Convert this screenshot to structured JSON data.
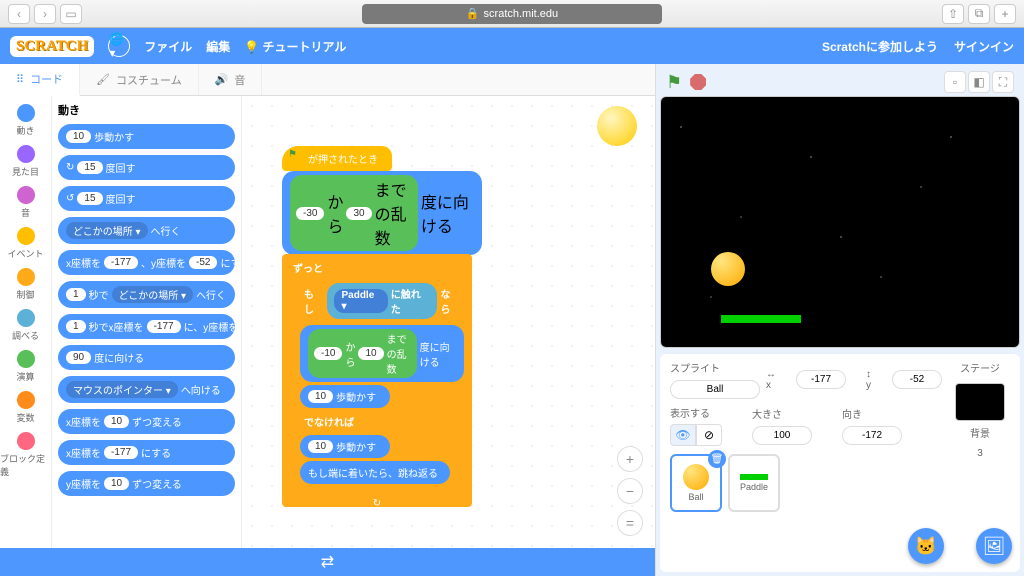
{
  "browser": {
    "url": "scratch.mit.edu"
  },
  "menu": {
    "file": "ファイル",
    "edit": "編集",
    "tutorials": "チュートリアル",
    "join": "Scratchに参加しよう",
    "signin": "サインイン"
  },
  "tabs": {
    "code": "コード",
    "costumes": "コスチューム",
    "sounds": "音"
  },
  "categories": [
    {
      "label": "動き",
      "color": "#4c97ff"
    },
    {
      "label": "見た目",
      "color": "#9966ff"
    },
    {
      "label": "音",
      "color": "#cf63cf"
    },
    {
      "label": "イベント",
      "color": "#ffbf00"
    },
    {
      "label": "制御",
      "color": "#ffab19"
    },
    {
      "label": "調べる",
      "color": "#5cb1d6"
    },
    {
      "label": "演算",
      "color": "#59c059"
    },
    {
      "label": "変数",
      "color": "#ff8c1a"
    },
    {
      "label": "ブロック定義",
      "color": "#ff6680"
    }
  ],
  "palette": {
    "heading": "動き",
    "blocks": {
      "move_steps": {
        "val": "10",
        "suf": "歩動かす"
      },
      "turn_cw": {
        "val": "15",
        "suf": "度回す"
      },
      "turn_ccw": {
        "val": "15",
        "suf": "度回す"
      },
      "goto": {
        "dd": "どこかの場所 ▾",
        "suf": "へ行く"
      },
      "gotoxy": {
        "pre": "x座標を",
        "x": "-177",
        "mid": "、y座標を",
        "y": "-52",
        "suf": "にする"
      },
      "glide": {
        "sec": "1",
        "mid": "秒で",
        "dd": "どこかの場所 ▾",
        "suf": "へ行く"
      },
      "glidexy": {
        "sec": "1",
        "mid": "秒でx座標を",
        "x": "-177",
        "mid2": "に、y座標を"
      },
      "point_dir": {
        "val": "90",
        "suf": "度に向ける"
      },
      "point_towards": {
        "dd": "マウスのポインター ▾",
        "suf": "へ向ける"
      },
      "changex": {
        "pre": "x座標を",
        "val": "10",
        "suf": "ずつ変える"
      },
      "setx": {
        "pre": "x座標を",
        "val": "-177",
        "suf": "にする"
      },
      "changey": {
        "pre": "y座標を",
        "val": "10",
        "suf": "ずつ変える"
      }
    }
  },
  "script": {
    "hat": "が押されたとき",
    "pointrand": {
      "pre": "",
      "from": "-30",
      "mid": "から",
      "to": "30",
      "suf": "までの乱数",
      "end": "度に向ける"
    },
    "forever": "ずっと",
    "if": "もし",
    "then": "なら",
    "touching": {
      "pre": "",
      "dd": "Paddle ▾",
      "suf": "に触れた"
    },
    "pointrand2": {
      "from": "-10",
      "mid": "から",
      "to": "10",
      "suf": "までの乱数",
      "end": "度に向ける"
    },
    "move1": {
      "val": "10",
      "suf": "歩動かす"
    },
    "else": "でなければ",
    "move2": {
      "val": "10",
      "suf": "歩動かす"
    },
    "bounce": "もし端に着いたら、跳ね返る"
  },
  "sprite_panel": {
    "sprite_label": "スプライト",
    "name": "Ball",
    "x_label": "x",
    "x": "-177",
    "y_label": "y",
    "y": "-52",
    "show_label": "表示する",
    "size_label": "大きさ",
    "size": "100",
    "dir_label": "向き",
    "dir": "-172",
    "sprites": [
      {
        "name": "Ball"
      },
      {
        "name": "Paddle"
      }
    ],
    "stage_label": "ステージ",
    "backdrop_label": "背景",
    "backdrop_count": "3"
  }
}
